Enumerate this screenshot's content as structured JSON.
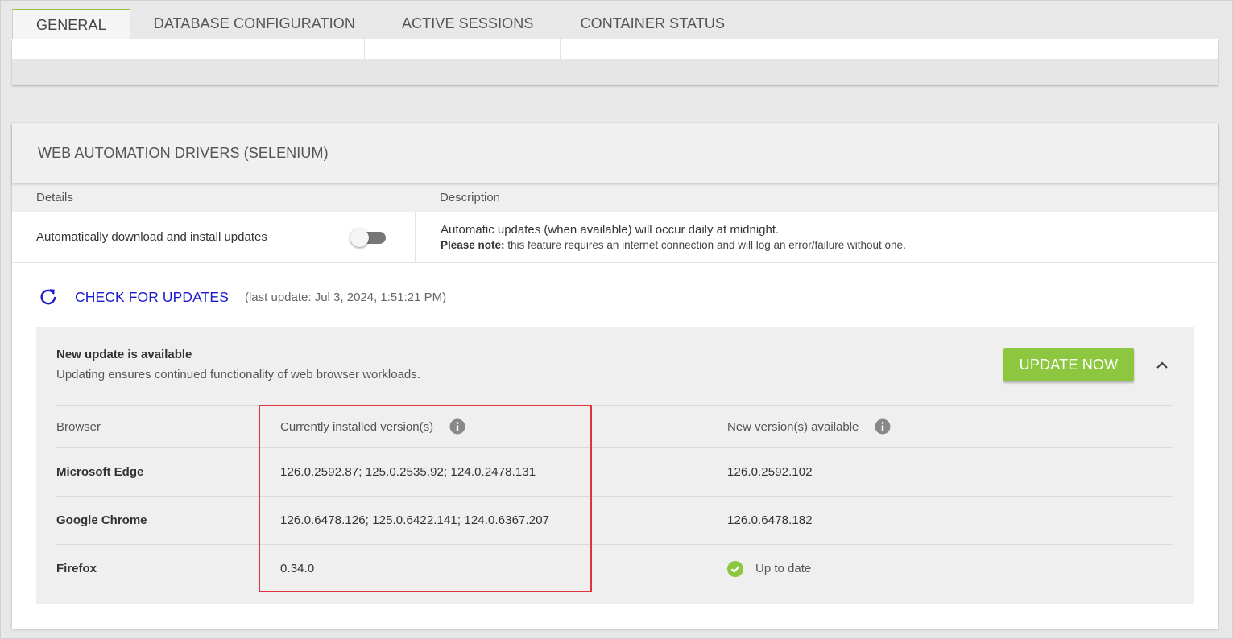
{
  "tabs": [
    {
      "label": "GENERAL",
      "active": true
    },
    {
      "label": "DATABASE CONFIGURATION",
      "active": false
    },
    {
      "label": "ACTIVE SESSIONS",
      "active": false
    },
    {
      "label": "CONTAINER STATUS",
      "active": false
    }
  ],
  "section": {
    "title": "WEB AUTOMATION DRIVERS (SELENIUM)",
    "columns": {
      "details": "Details",
      "description": "Description"
    },
    "auto_update": {
      "label": "Automatically download and install updates",
      "enabled": false,
      "description": "Automatic updates (when available) will occur daily at midnight.",
      "note_label": "Please note:",
      "note_text": " this feature requires an internet connection and will log an error/failure without one."
    },
    "check": {
      "link_label": "CHECK FOR UPDATES",
      "last_update": "(last update: Jul 3, 2024, 1:51:21 PM)"
    },
    "update_box": {
      "title": "New update is available",
      "subtitle": "Updating ensures continued functionality of web browser workloads.",
      "button_label": "UPDATE NOW",
      "table": {
        "headers": {
          "browser": "Browser",
          "installed": "Currently installed version(s)",
          "available": "New version(s) available"
        },
        "rows": [
          {
            "browser": "Microsoft Edge",
            "installed": "126.0.2592.87; 125.0.2535.92; 124.0.2478.131",
            "available": "126.0.2592.102"
          },
          {
            "browser": "Google Chrome",
            "installed": "126.0.6478.126; 125.0.6422.141; 124.0.6367.207",
            "available": "126.0.6478.182"
          },
          {
            "browser": "Firefox",
            "installed": "0.34.0",
            "available": "Up to date"
          }
        ]
      }
    }
  },
  "colors": {
    "accent_green": "#8dc63f",
    "link_blue": "#1a1acf",
    "highlight_red": "#e0333f"
  }
}
